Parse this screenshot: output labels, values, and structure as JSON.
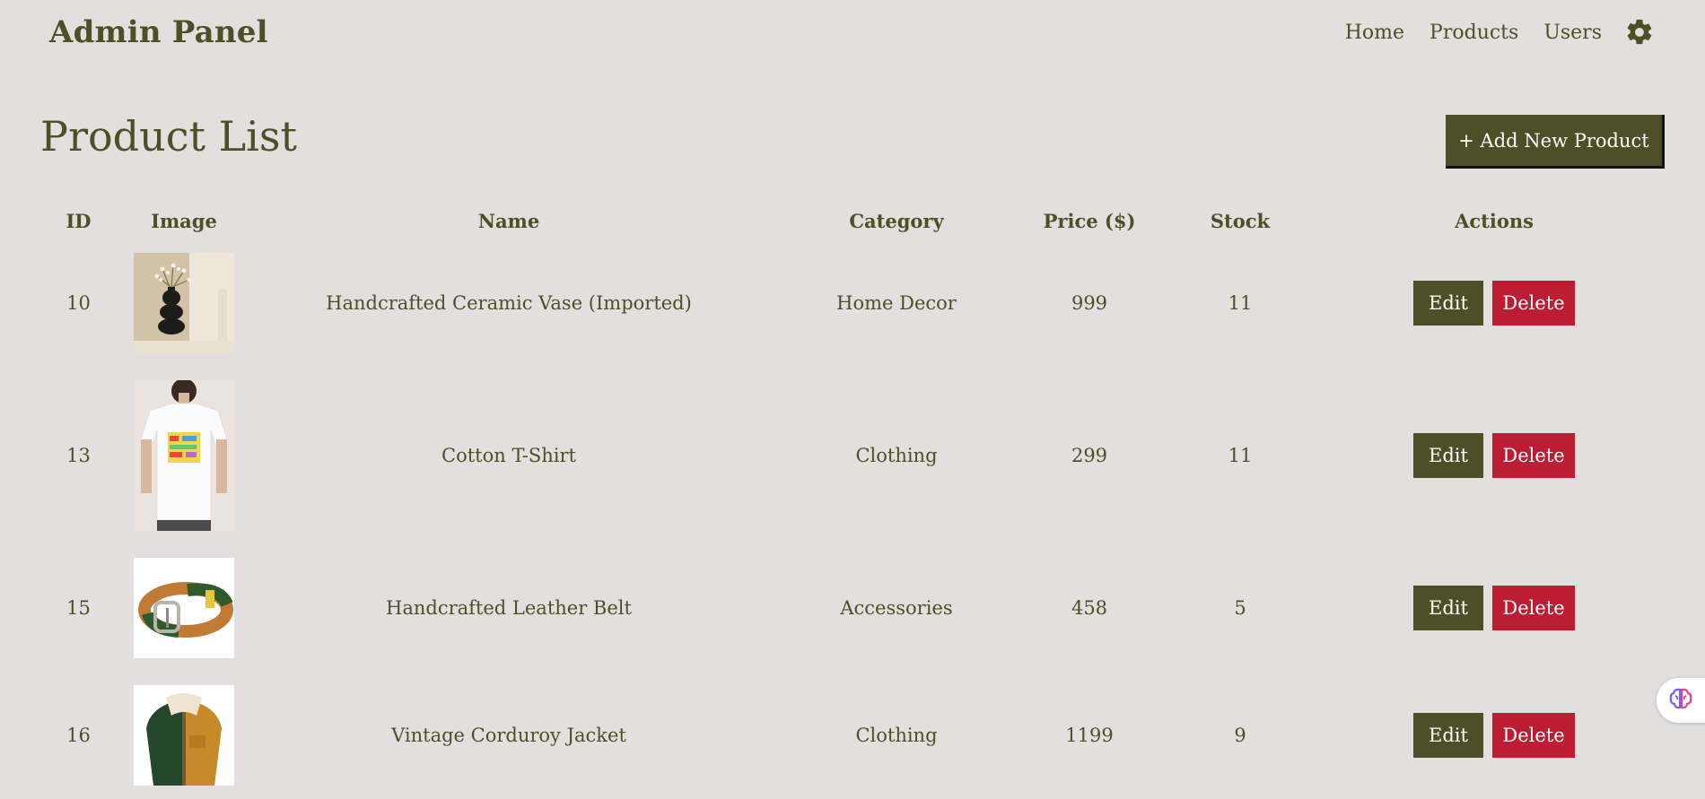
{
  "brand": {
    "title": "Admin Panel"
  },
  "nav": {
    "items": [
      {
        "label": "Home"
      },
      {
        "label": "Products"
      },
      {
        "label": "Users"
      }
    ],
    "settings_icon": "gear-icon"
  },
  "page": {
    "title": "Product List",
    "add_button_label": "+ Add New Product"
  },
  "table": {
    "columns": [
      "ID",
      "Image",
      "Name",
      "Category",
      "Price ($)",
      "Stock",
      "Actions"
    ],
    "rows": [
      {
        "id": "10",
        "image": "ceramic-vase-photo",
        "name": "Handcrafted Ceramic Vase (Imported)",
        "category": "Home Decor",
        "price": "999",
        "stock": "11",
        "edit_label": "Edit",
        "delete_label": "Delete"
      },
      {
        "id": "13",
        "image": "t-shirt-photo",
        "name": "Cotton T-Shirt",
        "category": "Clothing",
        "price": "299",
        "stock": "11",
        "edit_label": "Edit",
        "delete_label": "Delete"
      },
      {
        "id": "15",
        "image": "leather-belt-photo",
        "name": "Handcrafted Leather Belt",
        "category": "Accessories",
        "price": "458",
        "stock": "5",
        "edit_label": "Edit",
        "delete_label": "Delete"
      },
      {
        "id": "16",
        "image": "corduroy-jacket-photo",
        "name": "Vintage Corduroy Jacket",
        "category": "Clothing",
        "price": "1199",
        "stock": "9",
        "edit_label": "Edit",
        "delete_label": "Delete"
      }
    ]
  },
  "widget": {
    "icon": "brain-icon"
  },
  "colors": {
    "background": "#e2dfde",
    "primary": "#4e4f26",
    "danger": "#bc1d33"
  }
}
